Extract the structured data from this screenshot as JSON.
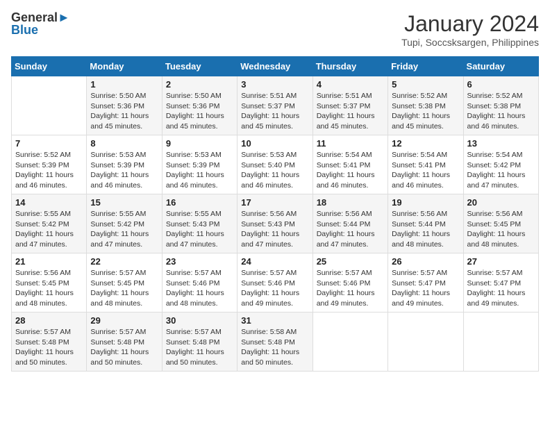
{
  "logo": {
    "line1": "General",
    "line2": "Blue"
  },
  "title": "January 2024",
  "location": "Tupi, Soccsksargen, Philippines",
  "weekdays": [
    "Sunday",
    "Monday",
    "Tuesday",
    "Wednesday",
    "Thursday",
    "Friday",
    "Saturday"
  ],
  "weeks": [
    [
      {
        "day": "",
        "info": ""
      },
      {
        "day": "1",
        "info": "Sunrise: 5:50 AM\nSunset: 5:36 PM\nDaylight: 11 hours\nand 45 minutes."
      },
      {
        "day": "2",
        "info": "Sunrise: 5:50 AM\nSunset: 5:36 PM\nDaylight: 11 hours\nand 45 minutes."
      },
      {
        "day": "3",
        "info": "Sunrise: 5:51 AM\nSunset: 5:37 PM\nDaylight: 11 hours\nand 45 minutes."
      },
      {
        "day": "4",
        "info": "Sunrise: 5:51 AM\nSunset: 5:37 PM\nDaylight: 11 hours\nand 45 minutes."
      },
      {
        "day": "5",
        "info": "Sunrise: 5:52 AM\nSunset: 5:38 PM\nDaylight: 11 hours\nand 45 minutes."
      },
      {
        "day": "6",
        "info": "Sunrise: 5:52 AM\nSunset: 5:38 PM\nDaylight: 11 hours\nand 46 minutes."
      }
    ],
    [
      {
        "day": "7",
        "info": ""
      },
      {
        "day": "8",
        "info": "Sunrise: 5:53 AM\nSunset: 5:39 PM\nDaylight: 11 hours\nand 46 minutes."
      },
      {
        "day": "9",
        "info": "Sunrise: 5:53 AM\nSunset: 5:39 PM\nDaylight: 11 hours\nand 46 minutes."
      },
      {
        "day": "10",
        "info": "Sunrise: 5:53 AM\nSunset: 5:40 PM\nDaylight: 11 hours\nand 46 minutes."
      },
      {
        "day": "11",
        "info": "Sunrise: 5:54 AM\nSunset: 5:41 PM\nDaylight: 11 hours\nand 46 minutes."
      },
      {
        "day": "12",
        "info": "Sunrise: 5:54 AM\nSunset: 5:41 PM\nDaylight: 11 hours\nand 46 minutes."
      },
      {
        "day": "13",
        "info": "Sunrise: 5:54 AM\nSunset: 5:42 PM\nDaylight: 11 hours\nand 47 minutes."
      }
    ],
    [
      {
        "day": "14",
        "info": ""
      },
      {
        "day": "15",
        "info": "Sunrise: 5:55 AM\nSunset: 5:42 PM\nDaylight: 11 hours\nand 47 minutes."
      },
      {
        "day": "16",
        "info": "Sunrise: 5:55 AM\nSunset: 5:43 PM\nDaylight: 11 hours\nand 47 minutes."
      },
      {
        "day": "17",
        "info": "Sunrise: 5:56 AM\nSunset: 5:43 PM\nDaylight: 11 hours\nand 47 minutes."
      },
      {
        "day": "18",
        "info": "Sunrise: 5:56 AM\nSunset: 5:44 PM\nDaylight: 11 hours\nand 47 minutes."
      },
      {
        "day": "19",
        "info": "Sunrise: 5:56 AM\nSunset: 5:44 PM\nDaylight: 11 hours\nand 48 minutes."
      },
      {
        "day": "20",
        "info": "Sunrise: 5:56 AM\nSunset: 5:45 PM\nDaylight: 11 hours\nand 48 minutes."
      }
    ],
    [
      {
        "day": "21",
        "info": ""
      },
      {
        "day": "22",
        "info": "Sunrise: 5:57 AM\nSunset: 5:45 PM\nDaylight: 11 hours\nand 48 minutes."
      },
      {
        "day": "23",
        "info": "Sunrise: 5:57 AM\nSunset: 5:46 PM\nDaylight: 11 hours\nand 48 minutes."
      },
      {
        "day": "24",
        "info": "Sunrise: 5:57 AM\nSunset: 5:46 PM\nDaylight: 11 hours\nand 49 minutes."
      },
      {
        "day": "25",
        "info": "Sunrise: 5:57 AM\nSunset: 5:46 PM\nDaylight: 11 hours\nand 49 minutes."
      },
      {
        "day": "26",
        "info": "Sunrise: 5:57 AM\nSunset: 5:47 PM\nDaylight: 11 hours\nand 49 minutes."
      },
      {
        "day": "27",
        "info": "Sunrise: 5:57 AM\nSunset: 5:47 PM\nDaylight: 11 hours\nand 49 minutes."
      }
    ],
    [
      {
        "day": "28",
        "info": "Sunrise: 5:57 AM\nSunset: 5:48 PM\nDaylight: 11 hours\nand 50 minutes."
      },
      {
        "day": "29",
        "info": "Sunrise: 5:57 AM\nSunset: 5:48 PM\nDaylight: 11 hours\nand 50 minutes."
      },
      {
        "day": "30",
        "info": "Sunrise: 5:57 AM\nSunset: 5:48 PM\nDaylight: 11 hours\nand 50 minutes."
      },
      {
        "day": "31",
        "info": "Sunrise: 5:58 AM\nSunset: 5:48 PM\nDaylight: 11 hours\nand 50 minutes."
      },
      {
        "day": "",
        "info": ""
      },
      {
        "day": "",
        "info": ""
      },
      {
        "day": "",
        "info": ""
      }
    ]
  ],
  "week_day_info": {
    "7": "Sunrise: 5:52 AM\nSunset: 5:39 PM\nDaylight: 11 hours\nand 46 minutes.",
    "14": "Sunrise: 5:55 AM\nSunset: 5:42 PM\nDaylight: 11 hours\nand 47 minutes.",
    "21": "Sunrise: 5:56 AM\nSunset: 5:45 PM\nDaylight: 11 hours\nand 48 minutes."
  }
}
